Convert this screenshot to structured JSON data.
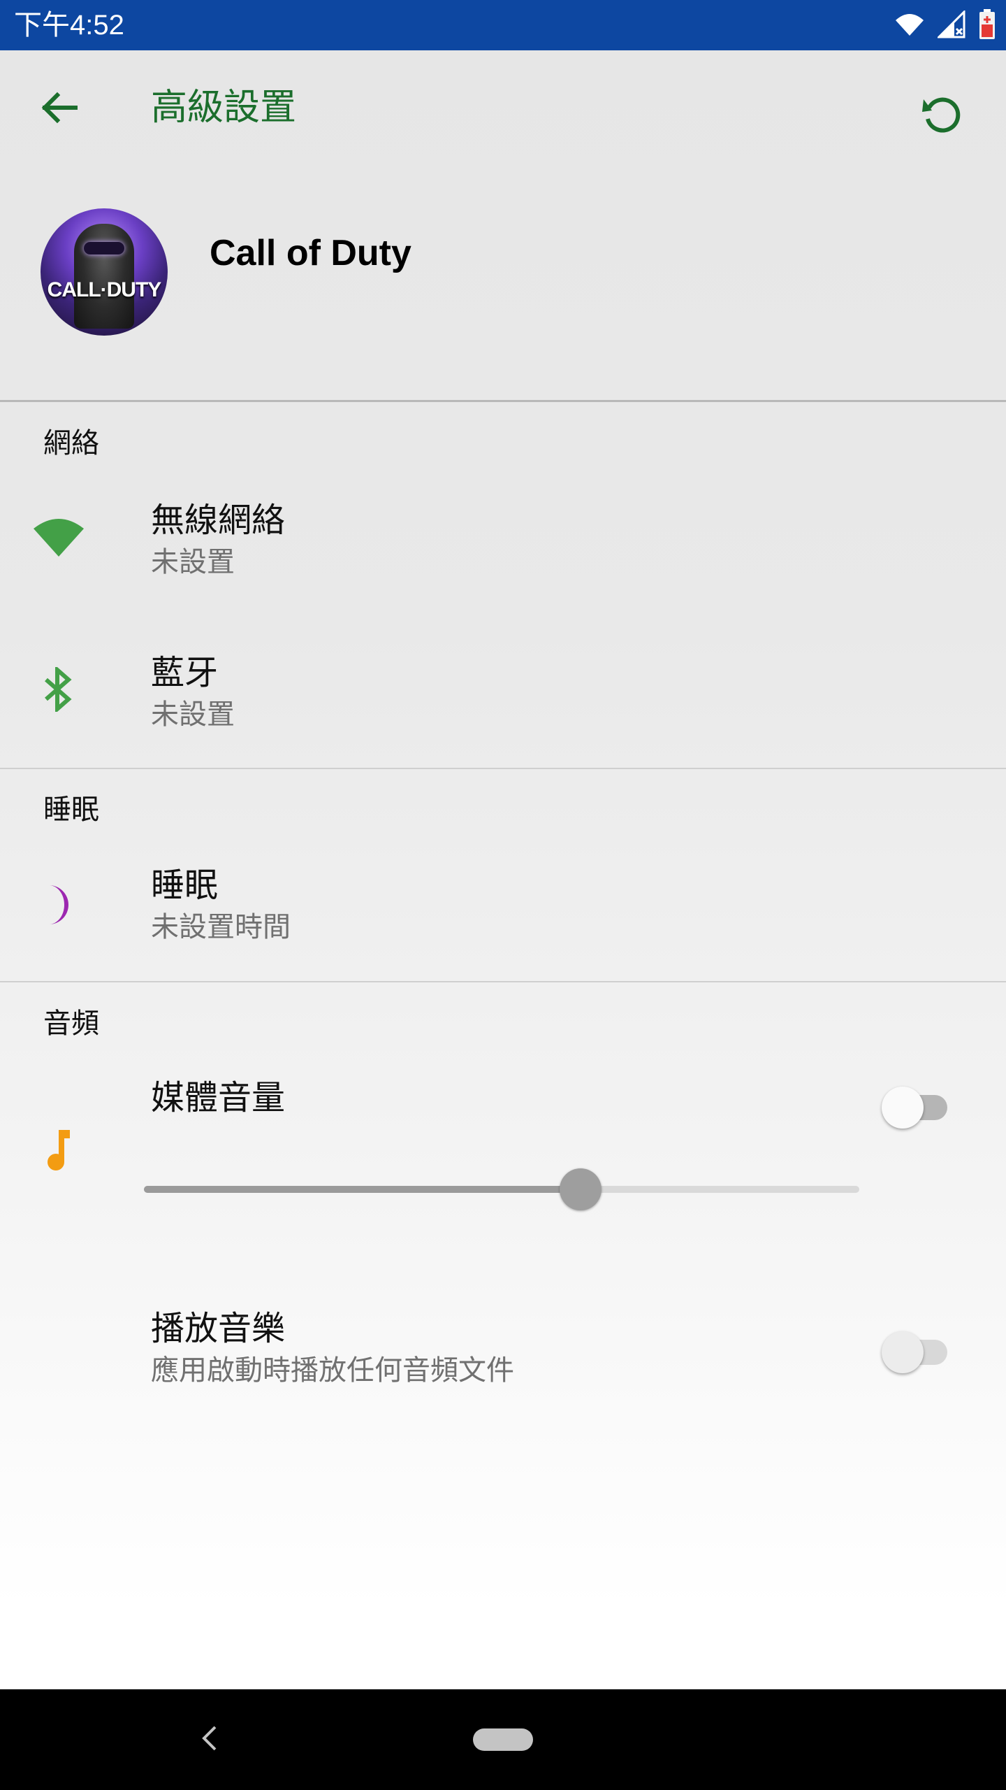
{
  "status_bar": {
    "time": "下午4:52",
    "icons": [
      "wifi-icon",
      "signal-no-service-icon",
      "battery-low-icon"
    ]
  },
  "app_bar": {
    "title": "高級設置",
    "back_icon": "arrow-left-icon",
    "action_icon": "refresh-icon"
  },
  "app": {
    "name": "Call of Duty",
    "icon_text": "CALL·DUTY"
  },
  "sections": {
    "network": {
      "title": "網絡",
      "wifi": {
        "title": "無線網絡",
        "subtitle": "未設置",
        "icon": "wifi-icon"
      },
      "bluetooth": {
        "title": "藍牙",
        "subtitle": "未設置",
        "icon": "bluetooth-icon"
      }
    },
    "sleep": {
      "title": "睡眠",
      "item": {
        "title": "睡眠",
        "subtitle": "未設置時間",
        "icon": "moon-icon"
      }
    },
    "audio": {
      "title": "音頻",
      "media_volume": {
        "title": "媒體音量",
        "enabled": false,
        "level": 0.61,
        "icon": "music-note-icon"
      },
      "play_music": {
        "title": "播放音樂",
        "subtitle": "應用啟動時播放任何音頻文件",
        "enabled": false
      }
    }
  },
  "colors": {
    "status_bar": "#0d47a1",
    "accent_green": "#1b6e2c",
    "wifi_icon": "#43a047",
    "moon_icon": "#9c27b0",
    "music_icon": "#f39c12"
  },
  "nav_bar": {
    "back_icon": "nav-back-icon",
    "home_icon": "nav-home-pill-icon"
  }
}
